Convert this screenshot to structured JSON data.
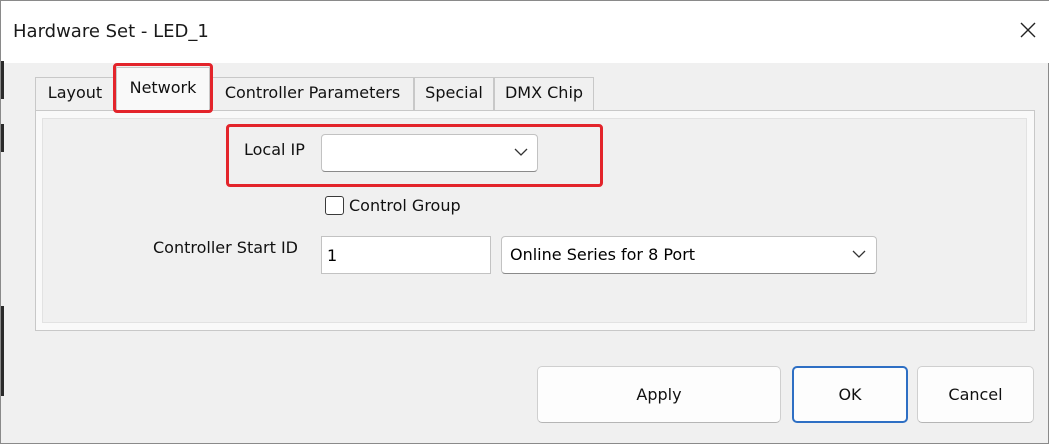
{
  "window": {
    "title": "Hardware Set - LED_1"
  },
  "tabs": [
    {
      "label": "Layout",
      "active": false
    },
    {
      "label": "Network",
      "active": true
    },
    {
      "label": "Controller Parameters",
      "active": false
    },
    {
      "label": "Special",
      "active": false
    },
    {
      "label": "DMX Chip",
      "active": false
    }
  ],
  "network": {
    "local_ip_label": "Local IP",
    "local_ip_value": "",
    "control_group_label": "Control Group",
    "control_group_checked": false,
    "controller_start_id_label": "Controller Start ID",
    "controller_start_id_value": "1",
    "series_value": "Online Series for 8 Port"
  },
  "buttons": {
    "apply": "Apply",
    "ok": "OK",
    "cancel": "Cancel"
  },
  "colors": {
    "highlight": "#e3242b",
    "default_button_border": "#2e6fc4"
  },
  "icons": {
    "close": "close-icon",
    "dropdown": "chevron-down-icon"
  }
}
